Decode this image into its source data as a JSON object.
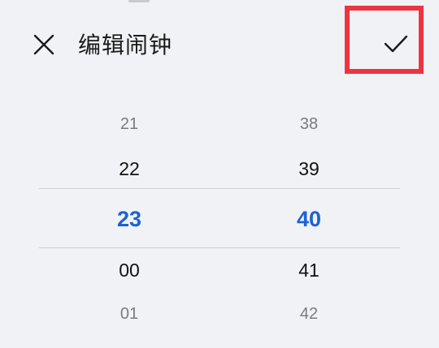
{
  "header": {
    "title": "编辑闹钟",
    "close_icon": "close-icon",
    "confirm_icon": "checkmark-icon"
  },
  "picker": {
    "hours": [
      "21",
      "22",
      "23",
      "00",
      "01"
    ],
    "minutes": [
      "38",
      "39",
      "40",
      "41",
      "42"
    ],
    "selected_hour": "23",
    "selected_minute": "40"
  },
  "colors": {
    "accent": "#1a63d4",
    "highlight_box": "#ef3340",
    "background": "#f1f2f6"
  }
}
